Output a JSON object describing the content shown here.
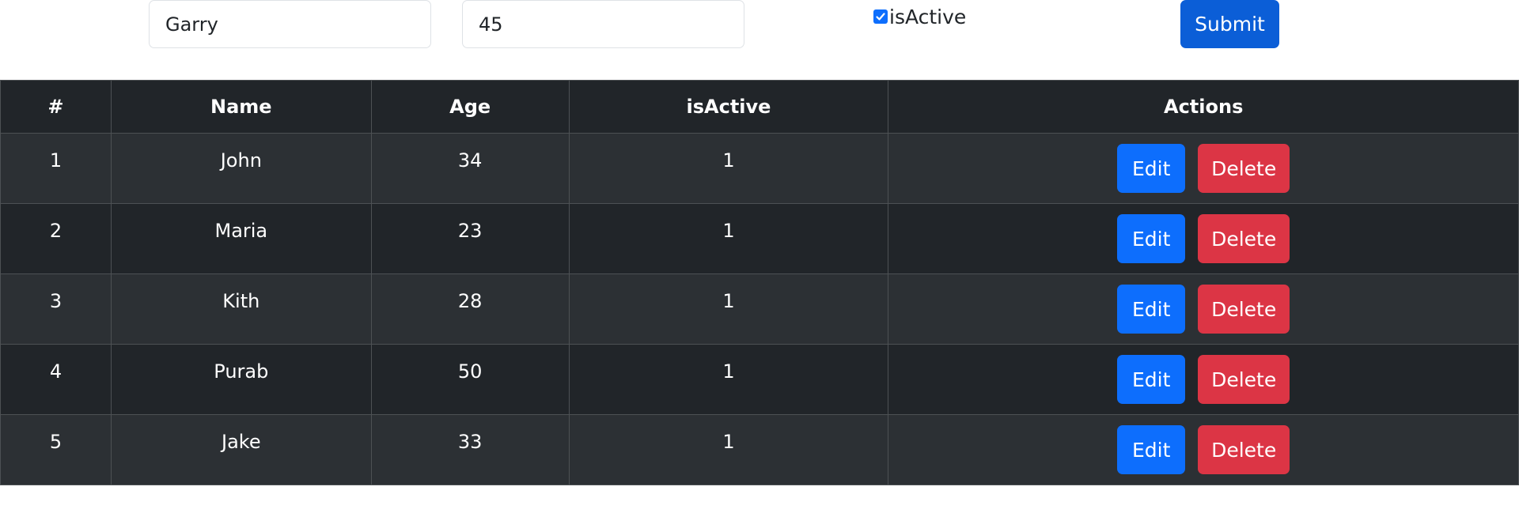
{
  "form": {
    "name_value": "Garry",
    "age_value": "45",
    "is_active_checked": true,
    "is_active_label": "isActive",
    "submit_label": "Submit"
  },
  "table": {
    "headers": [
      "#",
      "Name",
      "Age",
      "isActive",
      "Actions"
    ],
    "rows": [
      {
        "id": "1",
        "name": "John",
        "age": "34",
        "is_active": "1"
      },
      {
        "id": "2",
        "name": "Maria",
        "age": "23",
        "is_active": "1"
      },
      {
        "id": "3",
        "name": "Kith",
        "age": "28",
        "is_active": "1"
      },
      {
        "id": "4",
        "name": "Purab",
        "age": "50",
        "is_active": "1"
      },
      {
        "id": "5",
        "name": "Jake",
        "age": "33",
        "is_active": "1"
      }
    ],
    "edit_label": "Edit",
    "delete_label": "Delete"
  },
  "colors": {
    "primary": "#0d6efd",
    "danger": "#dc3545",
    "table_dark": "#212529",
    "table_striped": "#2c3034"
  }
}
